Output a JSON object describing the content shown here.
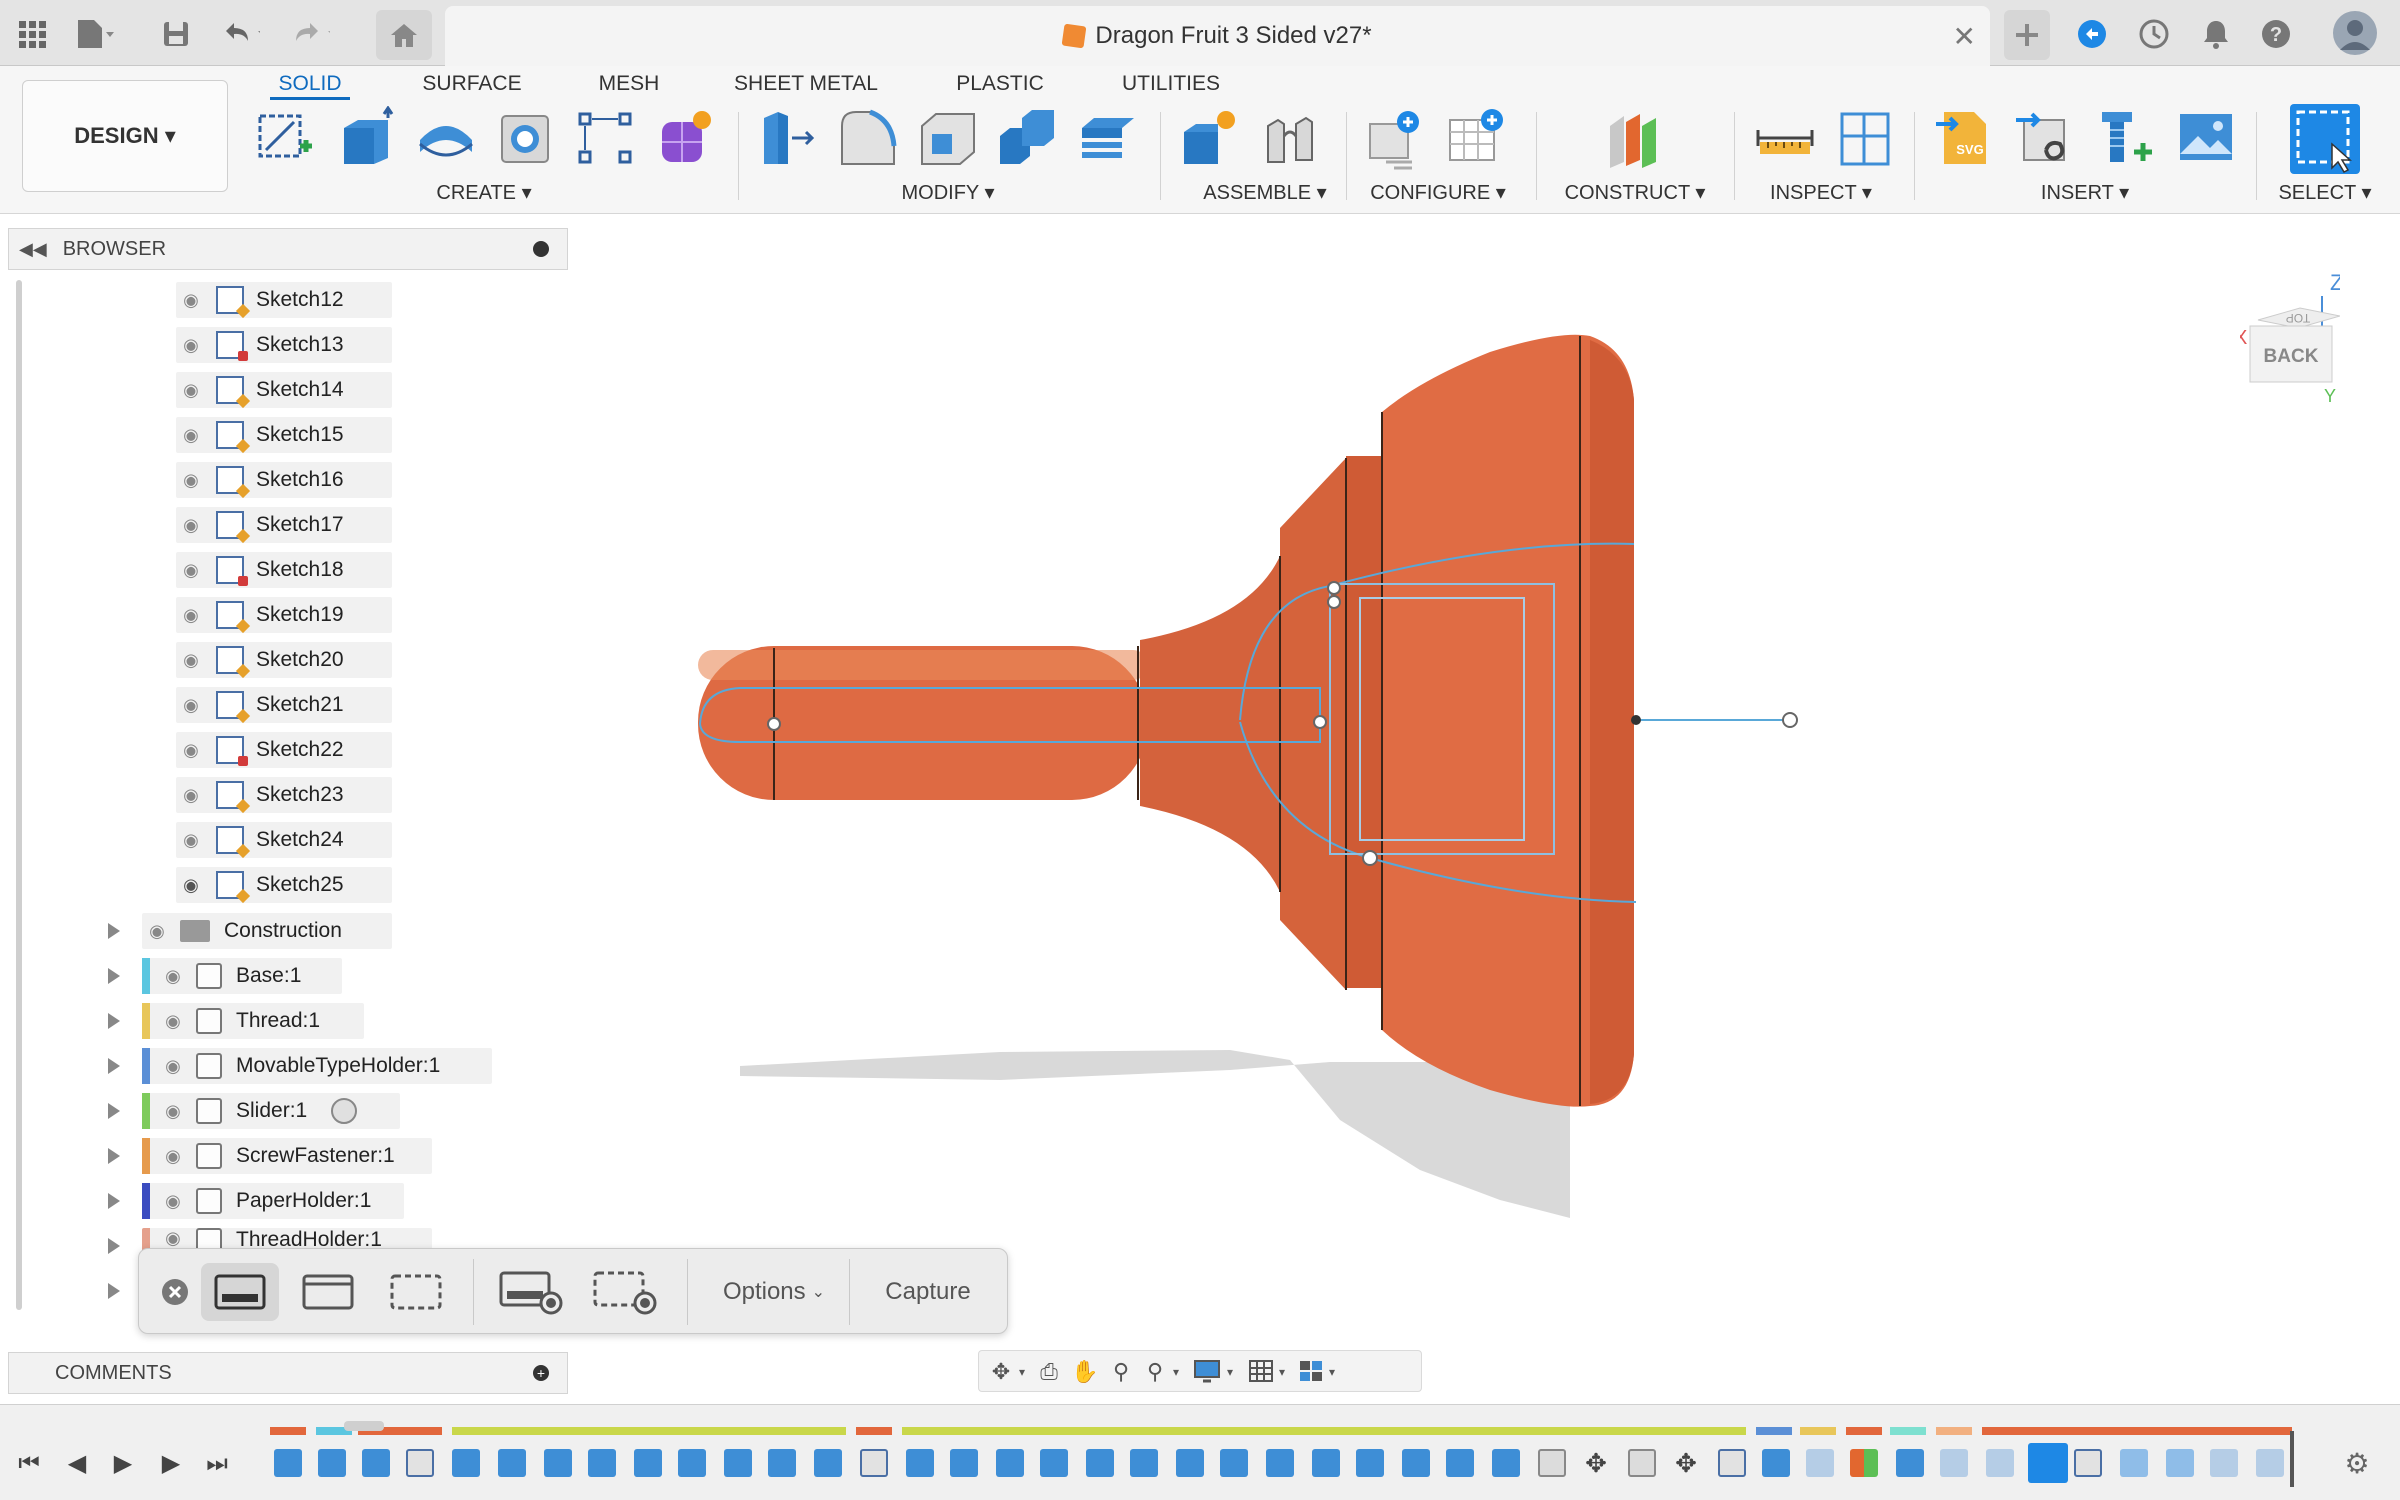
{
  "window": {
    "title": "Dragon Fruit 3 Sided v27*"
  },
  "mode_tabs": [
    {
      "label": "SOLID",
      "active": true
    },
    {
      "label": "SURFACE",
      "active": false
    },
    {
      "label": "MESH",
      "active": false
    },
    {
      "label": "SHEET METAL",
      "active": false
    },
    {
      "label": "PLASTIC",
      "active": false
    },
    {
      "label": "UTILITIES",
      "active": false
    }
  ],
  "workspace": {
    "label": "DESIGN ▾"
  },
  "toolbar_groups": [
    {
      "label": "CREATE ▾"
    },
    {
      "label": "MODIFY ▾"
    },
    {
      "label": "ASSEMBLE ▾"
    },
    {
      "label": "CONFIGURE ▾"
    },
    {
      "label": "CONSTRUCT ▾"
    },
    {
      "label": "INSPECT ▾"
    },
    {
      "label": "INSERT ▾"
    },
    {
      "label": "SELECT ▾"
    }
  ],
  "browser": {
    "title": "BROWSER",
    "sketches": [
      {
        "label": "Sketch12",
        "locked": false,
        "visible": false
      },
      {
        "label": "Sketch13",
        "locked": true,
        "visible": false
      },
      {
        "label": "Sketch14",
        "locked": false,
        "visible": false
      },
      {
        "label": "Sketch15",
        "locked": false,
        "visible": false
      },
      {
        "label": "Sketch16",
        "locked": false,
        "visible": false
      },
      {
        "label": "Sketch17",
        "locked": false,
        "visible": false
      },
      {
        "label": "Sketch18",
        "locked": true,
        "visible": false
      },
      {
        "label": "Sketch19",
        "locked": false,
        "visible": false
      },
      {
        "label": "Sketch20",
        "locked": false,
        "visible": false
      },
      {
        "label": "Sketch21",
        "locked": false,
        "visible": false
      },
      {
        "label": "Sketch22",
        "locked": true,
        "visible": false
      },
      {
        "label": "Sketch23",
        "locked": false,
        "visible": false
      },
      {
        "label": "Sketch24",
        "locked": false,
        "visible": false
      },
      {
        "label": "Sketch25",
        "locked": false,
        "visible": true
      }
    ],
    "construction": {
      "label": "Construction"
    },
    "components": [
      {
        "label": "Base:1",
        "color": "#5bc6e0"
      },
      {
        "label": "Thread:1",
        "color": "#e8c65a"
      },
      {
        "label": "MovableTypeHolder:1",
        "color": "#5b8fd6"
      },
      {
        "label": "Slider:1",
        "color": "#7ecb5c"
      },
      {
        "label": "ScrewFastener:1",
        "color": "#e69a4c"
      },
      {
        "label": "PaperHolder:1",
        "color": "#3b4cc0"
      },
      {
        "label": "ThreadHolder:1",
        "color": "#e5a08c"
      }
    ]
  },
  "comments": {
    "title": "COMMENTS"
  },
  "capture": {
    "options_label": "Options",
    "capture_label": "Capture"
  },
  "viewcube": {
    "face_label": "BACK",
    "top_label": "TOP",
    "axis_z": "Z",
    "axis_x": "X",
    "axis_y": "Y"
  },
  "colors": {
    "accent": "#0f6bbf",
    "model": "#de6a43",
    "sketch_line": "#59a8d8"
  }
}
